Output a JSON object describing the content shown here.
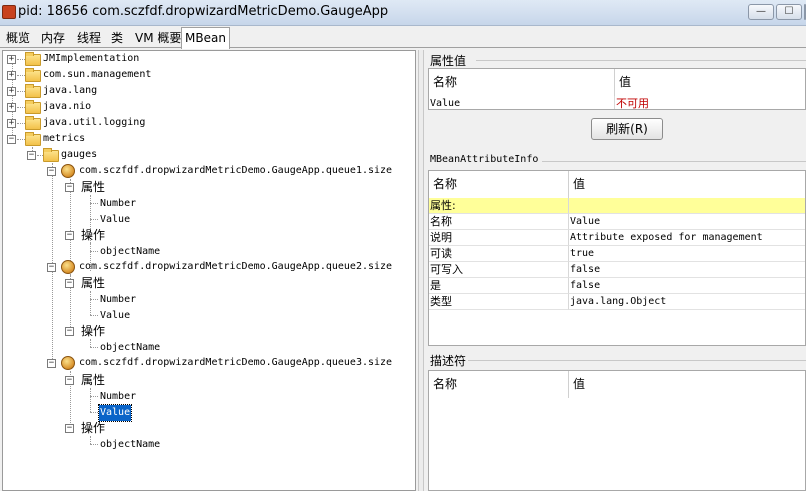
{
  "window": {
    "title": "pid: 18656 com.sczfdf.dropwizardMetricDemo.GaugeApp",
    "min": "—",
    "max": "☐"
  },
  "tabs": [
    {
      "label": "概览"
    },
    {
      "label": "内存"
    },
    {
      "label": "线程"
    },
    {
      "label": "类"
    },
    {
      "label": "VM 概要"
    },
    {
      "label": "MBean",
      "active": true
    }
  ],
  "tree": {
    "roots": [
      {
        "label": "JMImplementation"
      },
      {
        "label": "com.sun.management"
      },
      {
        "label": "java.lang"
      },
      {
        "label": "java.nio"
      },
      {
        "label": "java.util.logging"
      },
      {
        "label": "metrics"
      }
    ],
    "gauges": "gauges",
    "beans": [
      {
        "label": "com.sczfdf.dropwizardMetricDemo.GaugeApp.queue1.size"
      },
      {
        "label": "com.sczfdf.dropwizardMetricDemo.GaugeApp.queue2.size"
      },
      {
        "label": "com.sczfdf.dropwizardMetricDemo.GaugeApp.queue3.size"
      }
    ],
    "attributes_label": "属性",
    "operations_label": "操作",
    "attr_number": "Number",
    "attr_value": "Value",
    "op_object_name": "objectName",
    "selected": "Value",
    "expand_plus": "+",
    "expand_minus": "−"
  },
  "attr_values": {
    "title": "属性值",
    "col_name": "名称",
    "col_value": "值",
    "row_name": "Value",
    "row_value": "不可用",
    "refresh_label": "刷新(R)"
  },
  "info": {
    "title": "MBeanAttributeInfo",
    "col_name": "名称",
    "col_value": "值",
    "section_label": "属性:",
    "rows": [
      {
        "name": "名称",
        "value": "Value"
      },
      {
        "name": "说明",
        "value": "Attribute exposed for management"
      },
      {
        "name": "可读",
        "value": "true"
      },
      {
        "name": "可写入",
        "value": "false"
      },
      {
        "name": "是",
        "value": "false"
      },
      {
        "name": "类型",
        "value": "java.lang.Object"
      }
    ]
  },
  "descriptor": {
    "title": "描述符",
    "col_name": "名称",
    "col_value": "值"
  },
  "colors": {
    "selection": "#0a64c8",
    "highlight_row": "#ffff99",
    "unavailable": "#c00000"
  }
}
